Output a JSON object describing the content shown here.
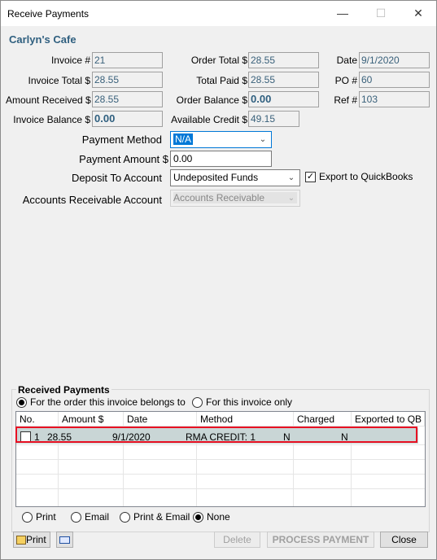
{
  "window": {
    "title": "Receive Payments",
    "minimize": "—",
    "maximize": "☐",
    "close": "✕"
  },
  "company": "Carlyn's Cafe",
  "fields": {
    "invoice_num": {
      "label": "Invoice #",
      "value": "21"
    },
    "invoice_total": {
      "label": "Invoice Total $",
      "value": "28.55"
    },
    "amount_received": {
      "label": "Amount Received $",
      "value": "28.55"
    },
    "invoice_balance": {
      "label": "Invoice Balance $",
      "value": "0.00"
    },
    "order_total": {
      "label": "Order Total $",
      "value": "28.55"
    },
    "total_paid": {
      "label": "Total Paid $",
      "value": "28.55"
    },
    "order_balance": {
      "label": "Order Balance $",
      "value": "0.00"
    },
    "available_credit": {
      "label": "Available Credit $",
      "value": "49.15"
    },
    "date": {
      "label": "Date",
      "value": "9/1/2020"
    },
    "po_num": {
      "label": "PO #",
      "value": "60"
    },
    "ref_num": {
      "label": "Ref #",
      "value": "103"
    }
  },
  "payment": {
    "method_label": "Payment Method",
    "method_value": "N/A",
    "amount_label": "Payment Amount $",
    "amount_value": "0.00",
    "deposit_label": "Deposit To Account",
    "deposit_value": "Undeposited Funds",
    "export_label": "Export to QuickBooks",
    "export_checked": "✓",
    "ar_label": "Accounts Receivable Account",
    "ar_value": "Accounts Receivable"
  },
  "received": {
    "title": "Received Payments",
    "scope_order": "For the order this invoice belongs to",
    "scope_invoice": "For this invoice only",
    "columns": [
      "No.",
      "Amount $",
      "Date",
      "Method",
      "Charged",
      "Exported to QB"
    ],
    "rows": [
      {
        "no": "1",
        "amount": "28.55",
        "date": "9/1/2020",
        "method": "RMA CREDIT: 1",
        "charged": "N",
        "exported": "N"
      }
    ]
  },
  "output_options": [
    "Print",
    "Email",
    "Print & Email",
    "None"
  ],
  "output_selected": "None",
  "buttons": {
    "print": "Print",
    "delete": "Delete",
    "process": "PROCESS PAYMENT",
    "close": "Close"
  },
  "colors": {
    "highlight_row": "#c9d6d6",
    "selection_border": "#e81123",
    "label_value": "#39607a"
  }
}
